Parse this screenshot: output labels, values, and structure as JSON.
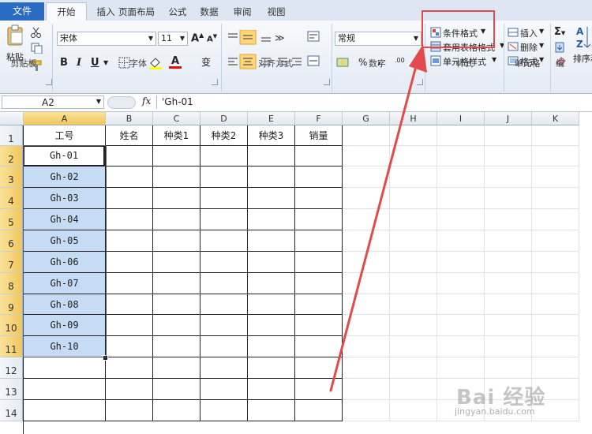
{
  "tabs": {
    "file": "文件",
    "home": "开始",
    "insert": "插入",
    "page_layout": "页面布局",
    "formulas": "公式",
    "data": "数据",
    "review": "审阅",
    "view": "视图"
  },
  "ribbon": {
    "clipboard": {
      "paste": "粘贴",
      "label": "剪贴板"
    },
    "font": {
      "name": "宋体",
      "size": "11",
      "bold": "B",
      "italic": "I",
      "underline": "U",
      "grow": "A",
      "shrink": "A",
      "font_color": "A",
      "phonetic": "变",
      "label": "字体"
    },
    "alignment": {
      "label": "对齐方式"
    },
    "number": {
      "format": "常规",
      "percent": "%",
      "comma": ",",
      "inc_decimal": ".00",
      "dec_decimal": ".00",
      "label": "数字"
    },
    "styles": {
      "conditional": "条件格式",
      "table": "套用表格格式",
      "cell": "单元格样式",
      "label": "样式"
    },
    "cells": {
      "insert": "插入",
      "delete": "删除",
      "format": "格式",
      "label": "单元格"
    },
    "editing": {
      "sum": "Σ",
      "sort_filter": "排序和",
      "label": "编"
    }
  },
  "formula_bar": {
    "name_box": "A2",
    "fx": "fx",
    "content": "'Gh-01"
  },
  "grid": {
    "columns": [
      "A",
      "B",
      "C",
      "D",
      "E",
      "F",
      "G",
      "H",
      "I",
      "J",
      "K"
    ],
    "rows": [
      "1",
      "2",
      "3",
      "4",
      "5",
      "6",
      "7",
      "8",
      "9",
      "10",
      "11",
      "12",
      "13",
      "14"
    ],
    "headers": [
      "工号",
      "姓名",
      "种类1",
      "种类2",
      "种类3",
      "销量"
    ],
    "ids": [
      "Gh-01",
      "Gh-02",
      "Gh-03",
      "Gh-04",
      "Gh-05",
      "Gh-06",
      "Gh-07",
      "Gh-08",
      "Gh-09",
      "Gh-10"
    ]
  },
  "watermark": {
    "main": "Bai 经验",
    "url": "jingyan.baidu.com"
  },
  "colors": {
    "accent": "#2a6cc2",
    "selection": "#c6dcf5",
    "annotation": "#e24b4b"
  }
}
